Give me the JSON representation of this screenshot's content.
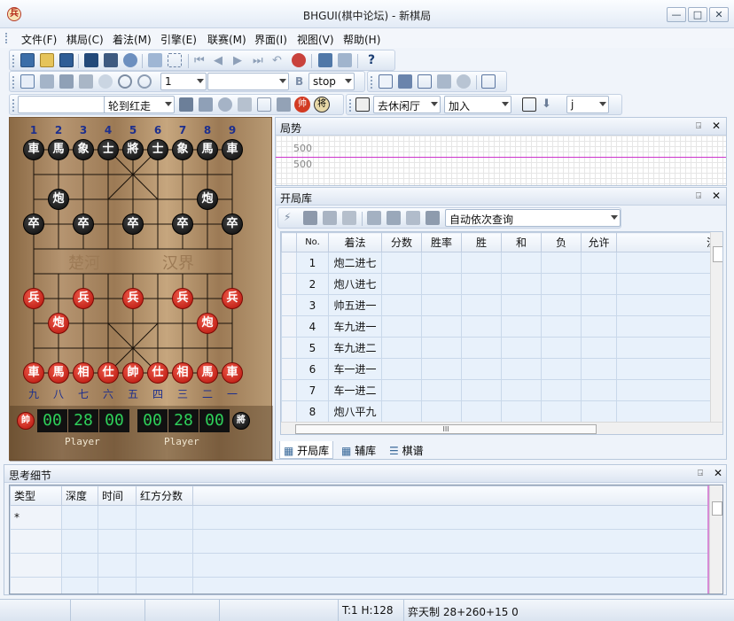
{
  "window": {
    "title": "BHGUI(棋中论坛) - 新棋局",
    "app_icon": "兵"
  },
  "menu": [
    "文件(F)",
    "棋局(C)",
    "着法(M)",
    "引擎(E)",
    "联赛(M)",
    "界面(I)",
    "视图(V)",
    "帮助(H)"
  ],
  "toolbar2": {
    "count_value": "1",
    "style_value": "stop"
  },
  "toolbar3": {
    "turn_value": "轮到红走",
    "hall_value": "去休闲厅",
    "join_value": "加入",
    "last_value": "j"
  },
  "board": {
    "top_files": [
      "1",
      "2",
      "3",
      "4",
      "5",
      "6",
      "7",
      "8",
      "9"
    ],
    "bottom_files": [
      "九",
      "八",
      "七",
      "六",
      "五",
      "四",
      "三",
      "二",
      "一"
    ],
    "river_left": "楚河",
    "river_right": "汉界",
    "black_pieces": [
      "車",
      "馬",
      "象",
      "士",
      "將",
      "士",
      "象",
      "馬",
      "車",
      "炮",
      "炮",
      "卒",
      "卒",
      "卒",
      "卒",
      "卒"
    ],
    "red_pieces": [
      "兵",
      "兵",
      "兵",
      "兵",
      "兵",
      "炮",
      "炮",
      "車",
      "馬",
      "相",
      "仕",
      "帥",
      "仕",
      "相",
      "馬",
      "車"
    ],
    "red_badge": "帥",
    "black_badge": "將",
    "red_clock_1": "00",
    "red_clock_2": "28",
    "red_clock_3": "00",
    "black_clock_1": "00",
    "black_clock_2": "28",
    "black_clock_3": "00",
    "red_player": "Player",
    "black_player": "Player"
  },
  "trend": {
    "title": "局势",
    "upper_label": "500",
    "lower_label": "500",
    "line_color": "#cc33cc"
  },
  "opening": {
    "title": "开局库",
    "query_mode": "自动依次查询",
    "columns": [
      "No.",
      "着法",
      "分数",
      "胜率",
      "胜",
      "和",
      "负",
      "允许",
      "注释"
    ],
    "rows": [
      {
        "no": "1",
        "move": "炮二进七"
      },
      {
        "no": "2",
        "move": "炮八进七"
      },
      {
        "no": "3",
        "move": "帅五进一"
      },
      {
        "no": "4",
        "move": "车九进一"
      },
      {
        "no": "5",
        "move": "车九进二"
      },
      {
        "no": "6",
        "move": "车一进一"
      },
      {
        "no": "7",
        "move": "车一进二"
      },
      {
        "no": "8",
        "move": "炮八平九"
      }
    ],
    "hscroll_mark": "III",
    "tabs": [
      "开局库",
      "辅库",
      "棋谱"
    ]
  },
  "thinking": {
    "title": "思考细节",
    "columns": [
      "类型",
      "深度",
      "时间",
      "红方分数"
    ],
    "rows": [
      [
        "*",
        "",
        "",
        ""
      ],
      [
        "",
        "",
        "",
        ""
      ],
      [
        "",
        "",
        "",
        ""
      ],
      [
        "",
        "",
        "",
        ""
      ]
    ]
  },
  "status": {
    "pos": "T:1 H:128",
    "rule": "弈天制 28+260+15 0"
  }
}
